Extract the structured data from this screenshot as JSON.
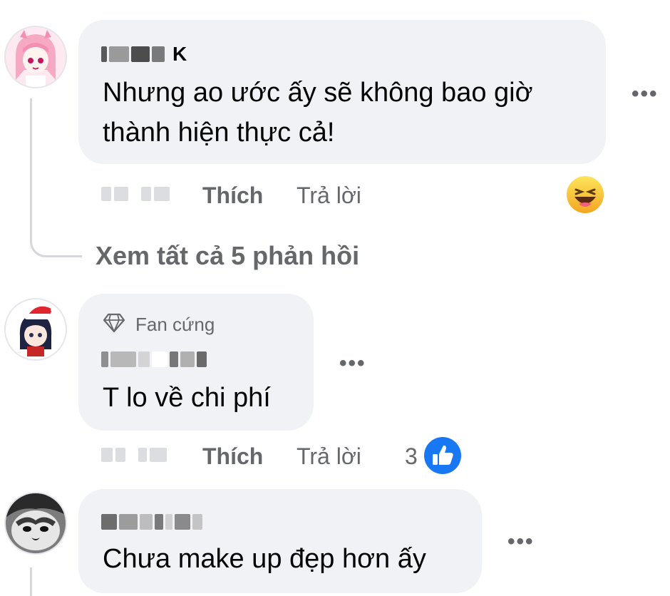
{
  "comments": [
    {
      "name_suffix": "K",
      "text_lines": [
        "Nhưng ao ước ấy sẽ không bao giờ",
        "thành hiện thực cả!"
      ],
      "actions": {
        "like": "Thích",
        "reply": "Trả lời"
      },
      "reaction_icon": "haha-emoji-icon",
      "more": "•••"
    },
    {
      "badge": "Fan cứng",
      "badge_icon": "diamond-icon",
      "text": "T lo về chi phí",
      "actions": {
        "like": "Thích",
        "reply": "Trả lời"
      },
      "reaction_count": "3",
      "reaction_icon": "like-reaction-icon",
      "more": "•••"
    },
    {
      "text": "Chưa make up đẹp hơn ấy",
      "more": "•••"
    }
  ],
  "view_all_replies": "Xem tất cả 5 phản hồi",
  "colors": {
    "bubble": "#f0f2f5",
    "secondary_text": "#65676b",
    "like_blue": "#1877f2",
    "haha_yellow": "#f7b125"
  }
}
